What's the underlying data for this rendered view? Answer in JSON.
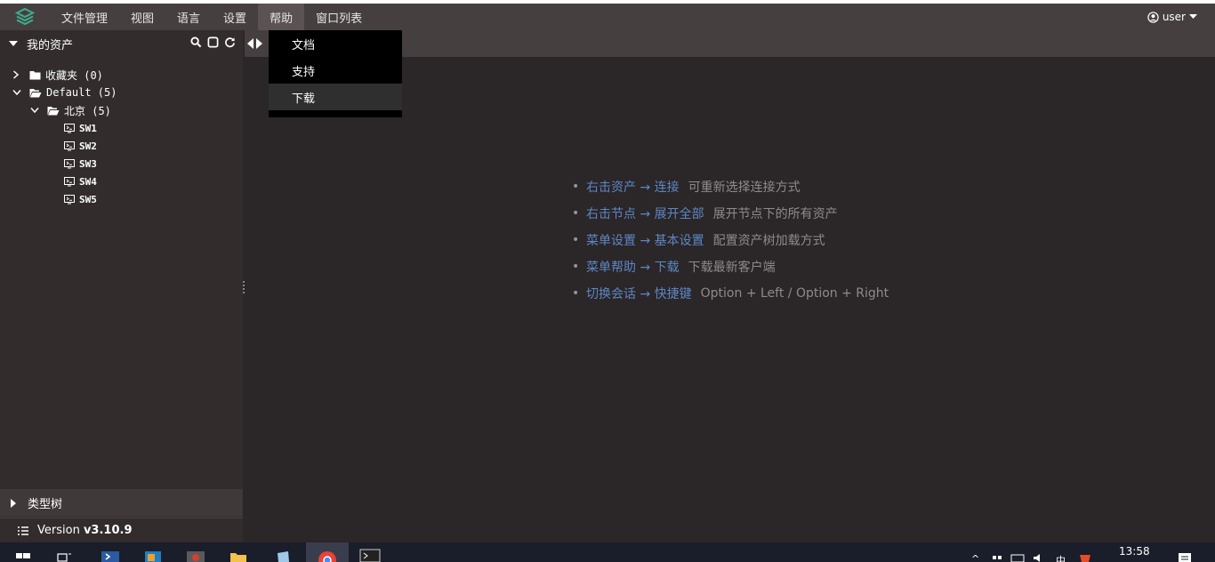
{
  "app": {
    "menu": [
      "文件管理",
      "视图",
      "语言",
      "设置",
      "帮助",
      "窗口列表"
    ],
    "active_menu": "帮助",
    "user": "user",
    "brand_color": "#3bb08f",
    "accent_link_color": "#5c87c6"
  },
  "help_menu": {
    "items": [
      "文档",
      "支持",
      "下载"
    ],
    "highlighted": "下载"
  },
  "sidebar": {
    "title": "我的资产",
    "tools": [
      "search-icon",
      "square-icon",
      "refresh-icon"
    ],
    "tree": [
      {
        "label": "收藏夹 (0)",
        "expanded": false,
        "level": 0,
        "type": "folder"
      },
      {
        "label": "Default (5)",
        "expanded": true,
        "level": 0,
        "type": "folder"
      },
      {
        "label": "北京 (5)",
        "expanded": true,
        "level": 1,
        "type": "folder"
      },
      {
        "label": "SW1",
        "level": 2,
        "type": "asset"
      },
      {
        "label": "SW2",
        "level": 2,
        "type": "asset"
      },
      {
        "label": "SW3",
        "level": 2,
        "type": "asset"
      },
      {
        "label": "SW4",
        "level": 2,
        "type": "asset"
      },
      {
        "label": "SW5",
        "level": 2,
        "type": "asset"
      }
    ],
    "type_tree": "类型树",
    "version_label": "Version",
    "version": "v3.10.9"
  },
  "tips": [
    {
      "link": "右击资产 → 连接",
      "desc": "可重新选择连接方式"
    },
    {
      "link": "右击节点 → 展开全部",
      "desc": "展开节点下的所有资产"
    },
    {
      "link": "菜单设置 → 基本设置",
      "desc": "配置资产树加载方式"
    },
    {
      "link": "菜单帮助 → 下载",
      "desc": "下载最新客户端"
    },
    {
      "link": "切换会话 → 快捷键",
      "desc": "Option + Left / Option + Right"
    }
  ],
  "taskbar": {
    "time": "13:58",
    "ime": "中"
  }
}
